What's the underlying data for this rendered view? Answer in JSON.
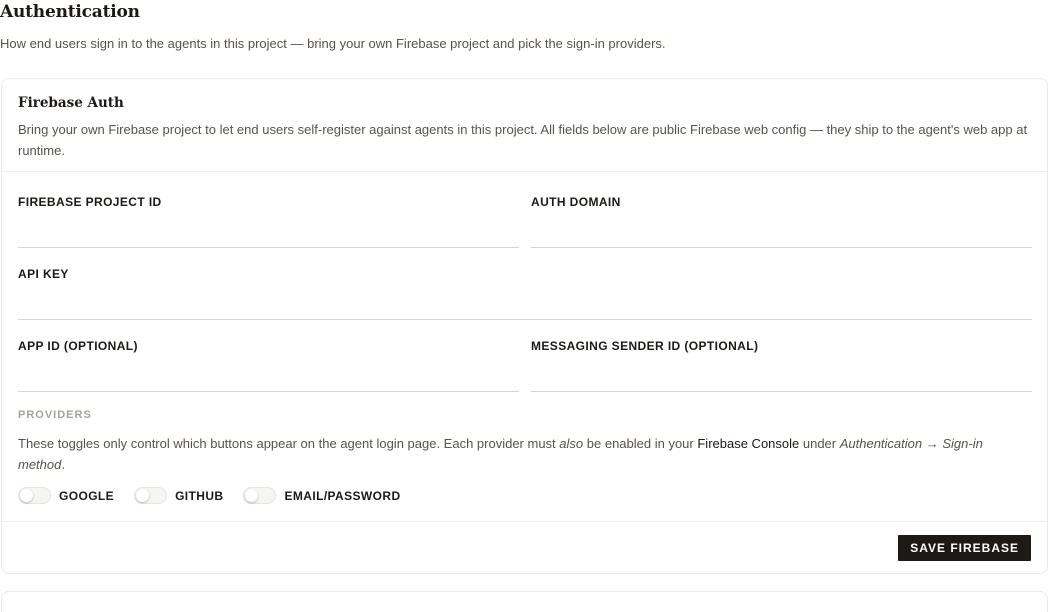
{
  "page": {
    "title": "Authentication",
    "subtitle": "How end users sign in to the agents in this project — bring your own Firebase project and pick the sign-in providers."
  },
  "firebase_card": {
    "title": "Firebase Auth",
    "description": "Bring your own Firebase project to let end users self-register against agents in this project. All fields below are public Firebase web config — they ship to the agent's web app at runtime.",
    "fields": {
      "project_id": {
        "label": "FIREBASE PROJECT ID",
        "value": "",
        "placeholder": ""
      },
      "auth_domain": {
        "label": "AUTH DOMAIN",
        "value": "",
        "placeholder": ""
      },
      "api_key": {
        "label": "API KEY",
        "value": "",
        "placeholder": ""
      },
      "app_id": {
        "label": "APP ID (OPTIONAL)",
        "value": "",
        "placeholder": ""
      },
      "messaging_sender_id": {
        "label": "MESSAGING SENDER ID (OPTIONAL)",
        "value": "",
        "placeholder": ""
      }
    },
    "providers": {
      "label": "PROVIDERS",
      "note_part1": "These toggles only control which buttons appear on the agent login page. Each provider must ",
      "note_em": "also",
      "note_part2": " be enabled in your ",
      "note_link": "Firebase Console",
      "note_part3": " under ",
      "note_path": "Authentication → Sign-in method",
      "note_end": ".",
      "items": [
        {
          "label": "GOOGLE",
          "enabled": false
        },
        {
          "label": "GITHUB",
          "enabled": false
        },
        {
          "label": "EMAIL/PASSWORD",
          "enabled": false
        }
      ]
    },
    "save_label": "SAVE FIREBASE"
  }
}
